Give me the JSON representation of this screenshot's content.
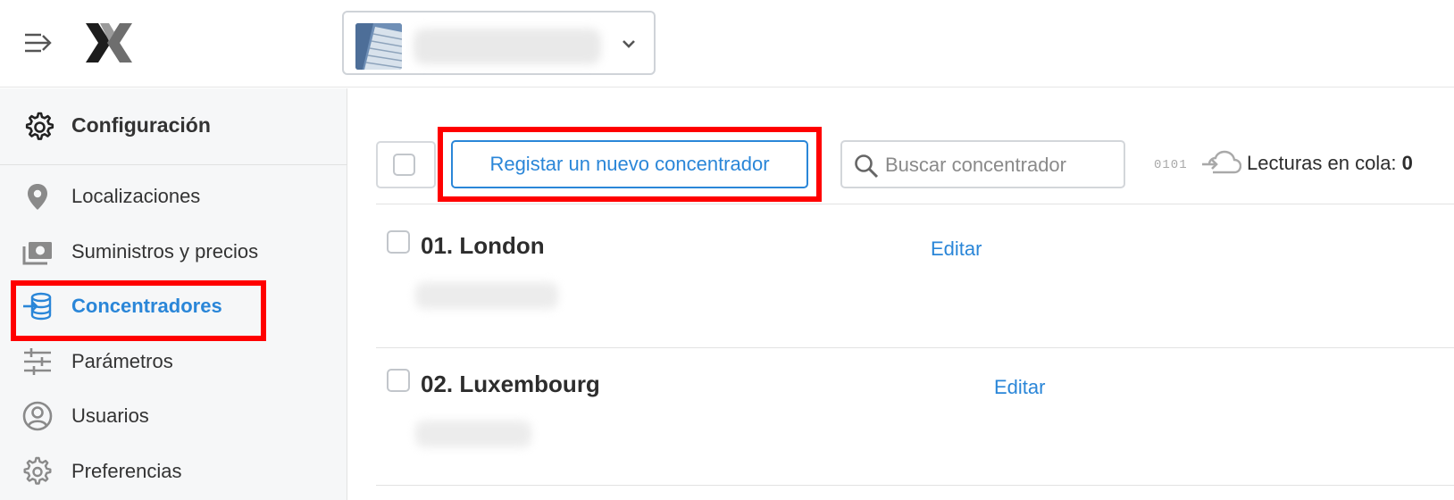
{
  "header": {
    "menu_icon": "menu-collapse-arrow-icon",
    "logo_icon": "x-logo-icon",
    "account_selector": {
      "thumbnail": "building-photo",
      "chevron_icon": "chevron-down-icon"
    }
  },
  "sidebar": {
    "title": "Configuración",
    "title_icon": "gear-icon",
    "items": [
      {
        "label": "Localizaciones",
        "icon": "map-pin-icon",
        "active": false
      },
      {
        "label": "Suministros y precios",
        "icon": "money-icon",
        "active": false
      },
      {
        "label": "Concentradores",
        "icon": "database-import-icon",
        "active": true
      },
      {
        "label": "Parámetros",
        "icon": "sliders-icon",
        "active": false
      },
      {
        "label": "Usuarios",
        "icon": "user-circle-icon",
        "active": false
      },
      {
        "label": "Preferencias",
        "icon": "gear-icon",
        "active": false
      }
    ]
  },
  "toolbar": {
    "register_label": "Registar un nuevo concentrador",
    "search_placeholder": "Buscar concentrador",
    "queue_bits": "0101",
    "queue_label": "Lecturas en cola:",
    "queue_count": "0"
  },
  "concentrators": [
    {
      "name": "01. London",
      "edit_label": "Editar"
    },
    {
      "name": "02. Luxembourg",
      "edit_label": "Editar"
    }
  ],
  "colors": {
    "accent": "#2a86d8",
    "highlight": "#ff0000",
    "sidebar_bg": "#f6f7f8"
  }
}
